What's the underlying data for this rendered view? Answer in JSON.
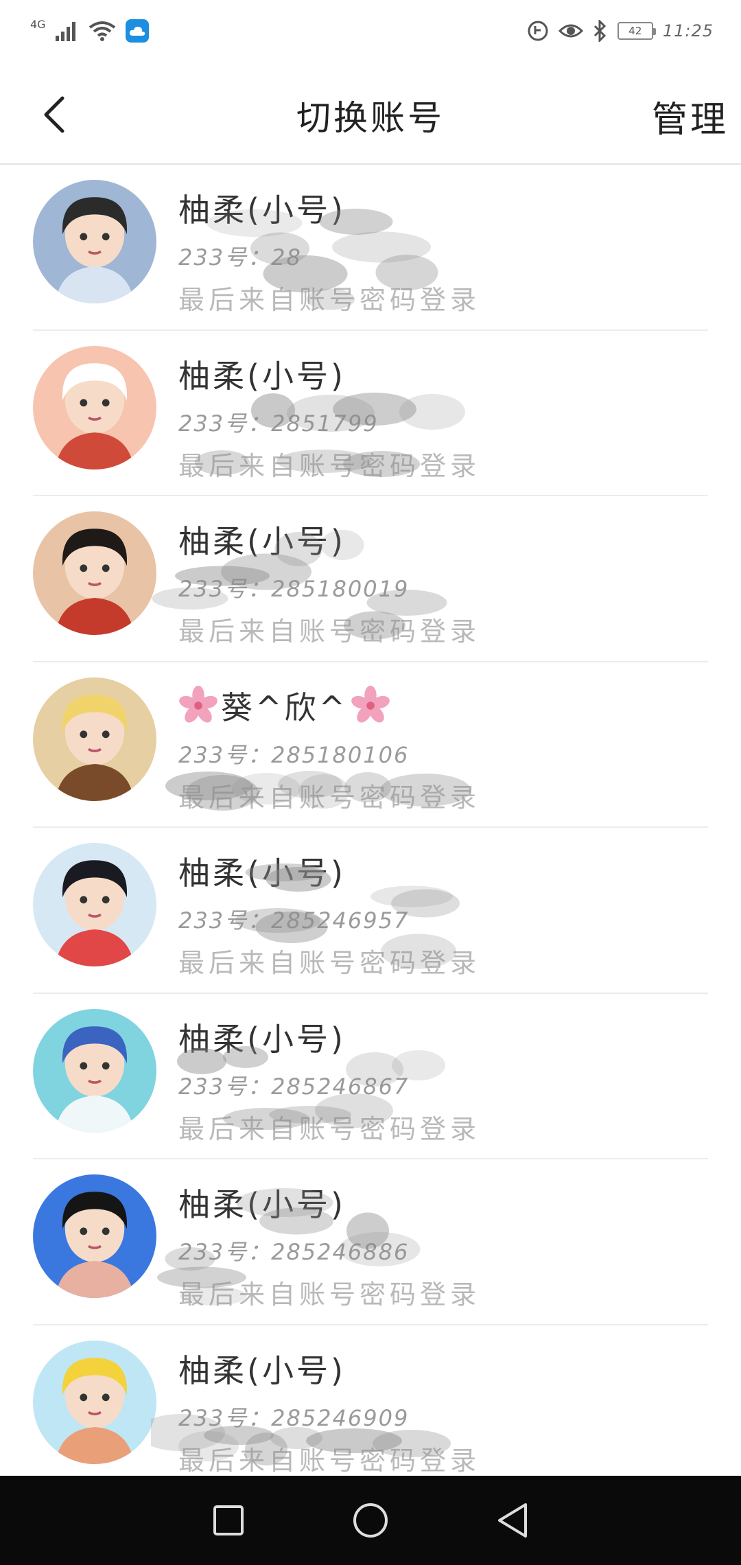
{
  "status_bar": {
    "network": "4G",
    "battery": "42",
    "time": "11:25"
  },
  "header": {
    "title": "切换账号",
    "manage_label": "管理"
  },
  "accounts": [
    {
      "name": "柚柔(小号)",
      "uid": "233号：28",
      "note": "最后来自账号密码登录",
      "avatar_colors": [
        "#9fb6d4",
        "#2b2b2b",
        "#d8e4f2"
      ]
    },
    {
      "name": "柚柔(小号)",
      "uid": "233号：2851799",
      "note": "最后来自账号密码登录",
      "avatar_colors": [
        "#f7c4b0",
        "#ffffff",
        "#d04a3a"
      ]
    },
    {
      "name": "柚柔(小号)",
      "uid": "233号：285180019",
      "note": "最后来自账号密码登录",
      "avatar_colors": [
        "#e9c3a5",
        "#1f1a18",
        "#c53b2b"
      ]
    },
    {
      "name": "葵^欣^",
      "uid": "233号：285180106",
      "note": "最后来自账号密码登录",
      "avatar_colors": [
        "#e6cfa2",
        "#f1d36b",
        "#7a4b2a"
      ]
    },
    {
      "name": "柚柔(小号)",
      "uid": "233号：285246957",
      "note": "最后来自账号密码登录",
      "avatar_colors": [
        "#d6e8f4",
        "#1a1a22",
        "#e24747"
      ]
    },
    {
      "name": "柚柔(小号)",
      "uid": "233号：285246867",
      "note": "最后来自账号密码登录",
      "avatar_colors": [
        "#7fd4e0",
        "#3a64c0",
        "#f0f7f8"
      ]
    },
    {
      "name": "柚柔(小号)",
      "uid": "233号：285246886",
      "note": "最后来自账号密码登录",
      "avatar_colors": [
        "#3a78e0",
        "#151515",
        "#e8b0a0"
      ]
    },
    {
      "name": "柚柔(小号)",
      "uid": "233号：285246909",
      "note": "最后来自账号密码登录",
      "avatar_colors": [
        "#bfe6f4",
        "#f3d23c",
        "#e9a078"
      ]
    }
  ]
}
